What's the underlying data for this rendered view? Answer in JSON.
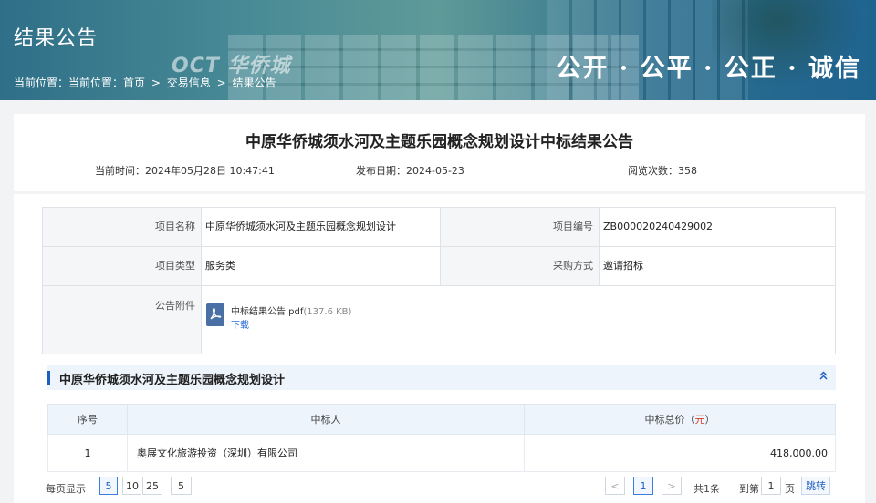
{
  "banner": {
    "title": "结果公告",
    "sign_text": "OCT 华侨城",
    "slogan": "公开 · 公平 · 公正 · 诚信",
    "breadcrumb": [
      "当前位置：",
      "当前位置：",
      "首页",
      ">",
      "交易信息",
      ">",
      "结果公告"
    ]
  },
  "announcement": {
    "title": "中原华侨城须水河及主题乐园概念规划设计中标结果公告",
    "current_time": "当前时间：2024年05月28日 10:47:41",
    "publish_date": "发布日期：2024-05-23",
    "views": "阅览次数：358"
  },
  "info": {
    "project_name_label": "项目名称",
    "project_name": "中原华侨城须水河及主题乐园概念规划设计",
    "project_no_label": "项目编号",
    "project_no": "ZB000020240429002",
    "project_type_label": "项目类型",
    "project_type": "服务类",
    "purchase_method_label": "采购方式",
    "purchase_method": "邀请招标",
    "attachment_label": "公告附件",
    "attachment_name": "中标结果公告.pdf",
    "attachment_size": "(137.6 KB)",
    "download_label": "下载"
  },
  "section": {
    "title": "中原华侨城须水河及主题乐园概念规划设计",
    "collapse_icon": "chevron-double-up-icon"
  },
  "result_table": {
    "headers": [
      "序号",
      "中标人",
      "中标总价（",
      "元",
      "）"
    ],
    "rows": [
      {
        "no": "1",
        "winner": "奥展文化旅游投资（深圳）有限公司",
        "price": "418,000.00"
      }
    ]
  },
  "pagination": {
    "per_page_label": "每页显示",
    "sizes": [
      "5",
      "10",
      "25"
    ],
    "size_select": "5",
    "prev": "<",
    "current_page": "1",
    "next": ">",
    "total": "共1条",
    "goto_prefix": "到第",
    "goto_value": "1",
    "goto_suffix": "页",
    "jump": "跳转"
  },
  "colors": {
    "accent": "#1d5fbe",
    "price_unit": "#d23c2a"
  }
}
